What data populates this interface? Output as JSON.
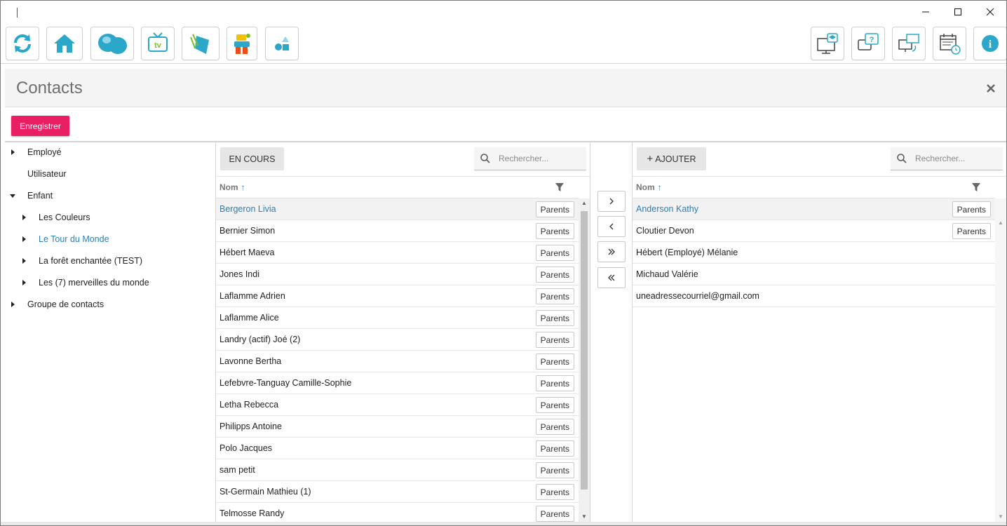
{
  "window": {
    "controls": [
      "minimize",
      "maximize",
      "close"
    ]
  },
  "toolbar": {
    "left_icons": [
      "refresh-icon",
      "home-icon",
      "cloud-icon",
      "tv-icon",
      "leaf-icon",
      "character-icon",
      "shapes-icon"
    ],
    "right_icons": [
      "monitor-education-icon",
      "help-chat-icon",
      "remote-desktop-icon",
      "calendar-clock-icon",
      "info-icon"
    ],
    "tv_label": "tv",
    "help_label": "?",
    "info_label": "i"
  },
  "page": {
    "title": "Contacts",
    "save_label": "Enregistrer"
  },
  "tree": [
    {
      "label": "Employé",
      "expandable": true,
      "expanded": false,
      "level": 0
    },
    {
      "label": "Utilisateur",
      "expandable": false,
      "level": 0
    },
    {
      "label": "Enfant",
      "expandable": true,
      "expanded": true,
      "level": 0
    },
    {
      "label": "Les Couleurs",
      "expandable": true,
      "expanded": false,
      "level": 1
    },
    {
      "label": "Le Tour du Monde",
      "expandable": true,
      "expanded": false,
      "level": 1,
      "selected": true
    },
    {
      "label": "La forêt enchantée (TEST)",
      "expandable": true,
      "expanded": false,
      "level": 1
    },
    {
      "label": "Les (7) merveilles du monde",
      "expandable": true,
      "expanded": false,
      "level": 1
    },
    {
      "label": "Groupe de contacts",
      "expandable": true,
      "expanded": false,
      "level": 0
    }
  ],
  "left_panel": {
    "filter_button": "EN COURS",
    "search_placeholder": "Rechercher...",
    "column": "Nom",
    "sort_arrow": "↑",
    "parents_label": "Parents",
    "rows": [
      {
        "name": "Bergeron Livia",
        "selected": true
      },
      {
        "name": "Bernier Simon"
      },
      {
        "name": "Hébert Maeva"
      },
      {
        "name": "Jones Indi"
      },
      {
        "name": "Laflamme Adrien"
      },
      {
        "name": "Laflamme Alice"
      },
      {
        "name": "Landry (actif) Joé (2)"
      },
      {
        "name": "Lavonne Bertha"
      },
      {
        "name": "Lefebvre-Tanguay Camille-Sophie"
      },
      {
        "name": "Letha Rebecca"
      },
      {
        "name": "Philipps Antoine"
      },
      {
        "name": "Polo Jacques"
      },
      {
        "name": "sam petit"
      },
      {
        "name": "St-Germain Mathieu (1)"
      },
      {
        "name": "Telmosse Randy"
      }
    ]
  },
  "transfer": {
    "buttons": [
      "move-right",
      "move-left",
      "move-all-right",
      "move-all-left"
    ]
  },
  "right_panel": {
    "add_button": "AJOUTER",
    "add_symbol": "+",
    "search_placeholder": "Rechercher...",
    "column": "Nom",
    "sort_arrow": "↑",
    "parents_label": "Parents",
    "rows": [
      {
        "name": "Anderson Kathy",
        "selected": true,
        "parents": true
      },
      {
        "name": "Cloutier Devon",
        "parents": true
      },
      {
        "name": "Hébert (Employé) Mélanie",
        "parents": false
      },
      {
        "name": "Michaud Valérie",
        "parents": false
      },
      {
        "name": "uneadressecourriel@gmail.com",
        "parents": false
      }
    ]
  },
  "colors": {
    "accent_blue": "#2a7fb5",
    "save_pink": "#e91e63",
    "icon_teal": "#2aa7c9"
  }
}
